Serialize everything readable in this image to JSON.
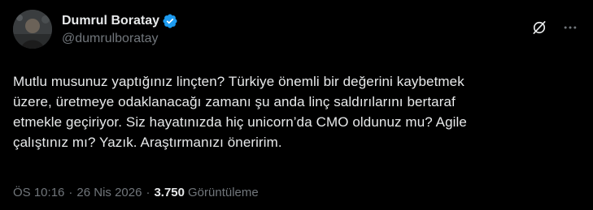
{
  "author": {
    "display_name": "Dumrul Boratay",
    "handle": "@dumrulboratay",
    "verified": true
  },
  "icons": {
    "verified": "verified-badge-icon",
    "grok": "grok-icon",
    "more": "more-horizontal-icon"
  },
  "tweet": {
    "lines": [
      "Mutlu musunuz yaptığınız linçten? Türkiye önemli bir değerini kaybetmek",
      "üzere, üretmeye odaklanacağı zamanı şu anda linç saldırılarını bertaraf",
      "etmekle geçiriyor. Siz hayatınızda hiç unicorn’da CMO oldunuz mu? Agile",
      "çalıştınız mı? Yazık. Araştırmanızı öneririm."
    ]
  },
  "meta": {
    "time": "ÖS 10:16",
    "separator": "·",
    "date": "26 Nis 2026",
    "views_count": "3.750",
    "views_label": "Görüntüleme"
  },
  "colors": {
    "background": "#000000",
    "text_primary": "#e7e9ea",
    "text_secondary": "#71767b",
    "verified_blue": "#1d9bf0"
  }
}
